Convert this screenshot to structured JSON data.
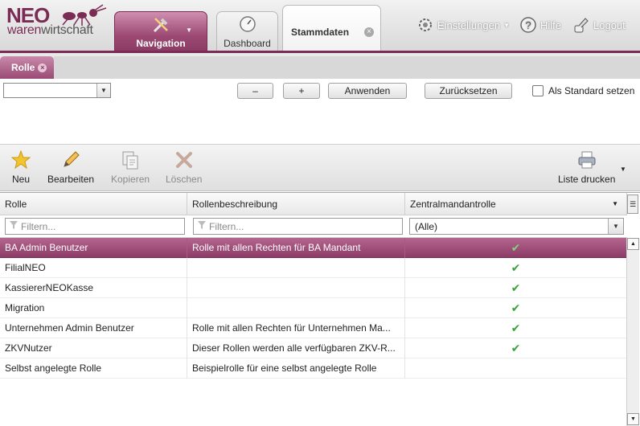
{
  "app": {
    "logo_top": "NEO",
    "logo_bottom_a": "waren",
    "logo_bottom_b": "wirtschaft"
  },
  "header": {
    "tabs": [
      {
        "label": "Navigation",
        "icon": "tools-icon"
      },
      {
        "label": "Dashboard",
        "icon": "gauge-icon"
      },
      {
        "label": "Stammdaten",
        "icon": "close-icon"
      }
    ],
    "settings_label": "Einstellungen",
    "help_label": "Hilfe",
    "logout_label": "Logout"
  },
  "subtab": {
    "label": "Rolle"
  },
  "filterbar": {
    "combo_value": "",
    "minus_label": "–",
    "plus_label": "+",
    "apply_label": "Anwenden",
    "reset_label": "Zurücksetzen",
    "standard_label": "Als Standard setzen",
    "standard_checked": false
  },
  "toolbar": {
    "new_label": "Neu",
    "edit_label": "Bearbeiten",
    "copy_label": "Kopieren",
    "delete_label": "Löschen",
    "print_label": "Liste drucken"
  },
  "grid": {
    "columns": [
      "Rolle",
      "Rollenbeschreibung",
      "Zentralmandantrolle"
    ],
    "filter_placeholder_1": "Filtern...",
    "filter_placeholder_2": "Filtern...",
    "filter_select_value": "(Alle)",
    "rows": [
      {
        "rolle": "BA Admin Benutzer",
        "beschreibung": "Rolle mit allen Rechten für BA Mandant",
        "zentral": true,
        "selected": true
      },
      {
        "rolle": "FilialNEO",
        "beschreibung": "",
        "zentral": true,
        "selected": false
      },
      {
        "rolle": "KassiererNEOKasse",
        "beschreibung": "",
        "zentral": true,
        "selected": false
      },
      {
        "rolle": "Migration",
        "beschreibung": "",
        "zentral": true,
        "selected": false
      },
      {
        "rolle": "Unternehmen Admin Benutzer",
        "beschreibung": "Rolle mit allen Rechten für Unternehmen Ma...",
        "zentral": true,
        "selected": false
      },
      {
        "rolle": "ZKVNutzer",
        "beschreibung": "Dieser Rollen werden alle verfügbaren ZKV-R...",
        "zentral": true,
        "selected": false
      },
      {
        "rolle": "Selbst angelegte Rolle",
        "beschreibung": "Beispielrolle für eine selbst angelegte Rolle",
        "zentral": false,
        "selected": false
      }
    ]
  },
  "colors": {
    "brand": "#7a2c55",
    "selected_row": "#9a4a73",
    "check": "#3aa33a"
  }
}
